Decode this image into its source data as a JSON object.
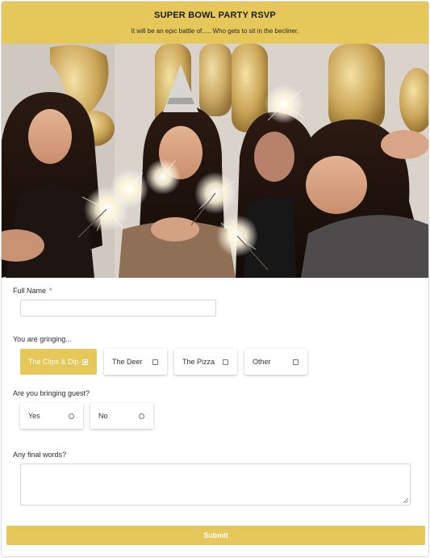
{
  "colors": {
    "accent": "#e5c75a"
  },
  "header": {
    "title": "SUPER BOWL PARTY RSVP",
    "subtitle": "It will be an epic battle of..... Who gets to sit in the becliner."
  },
  "photo": {
    "icon": "party-photo"
  },
  "full_name": {
    "label": "Full Name",
    "required_mark": "*",
    "value": ""
  },
  "bringing": {
    "label": "You are gringing...",
    "options": [
      {
        "label": "The Clips & Dip",
        "selected": true
      },
      {
        "label": "The Deer",
        "selected": false
      },
      {
        "label": "The Pizza",
        "selected": false
      },
      {
        "label": "Other",
        "selected": false
      }
    ]
  },
  "guest": {
    "label": "Are you bringing guest?",
    "options": [
      {
        "label": "Yes",
        "selected": false
      },
      {
        "label": "No",
        "selected": false
      }
    ]
  },
  "final_words": {
    "label": "Any final words?",
    "value": ""
  },
  "submit": {
    "label": "Submit"
  }
}
